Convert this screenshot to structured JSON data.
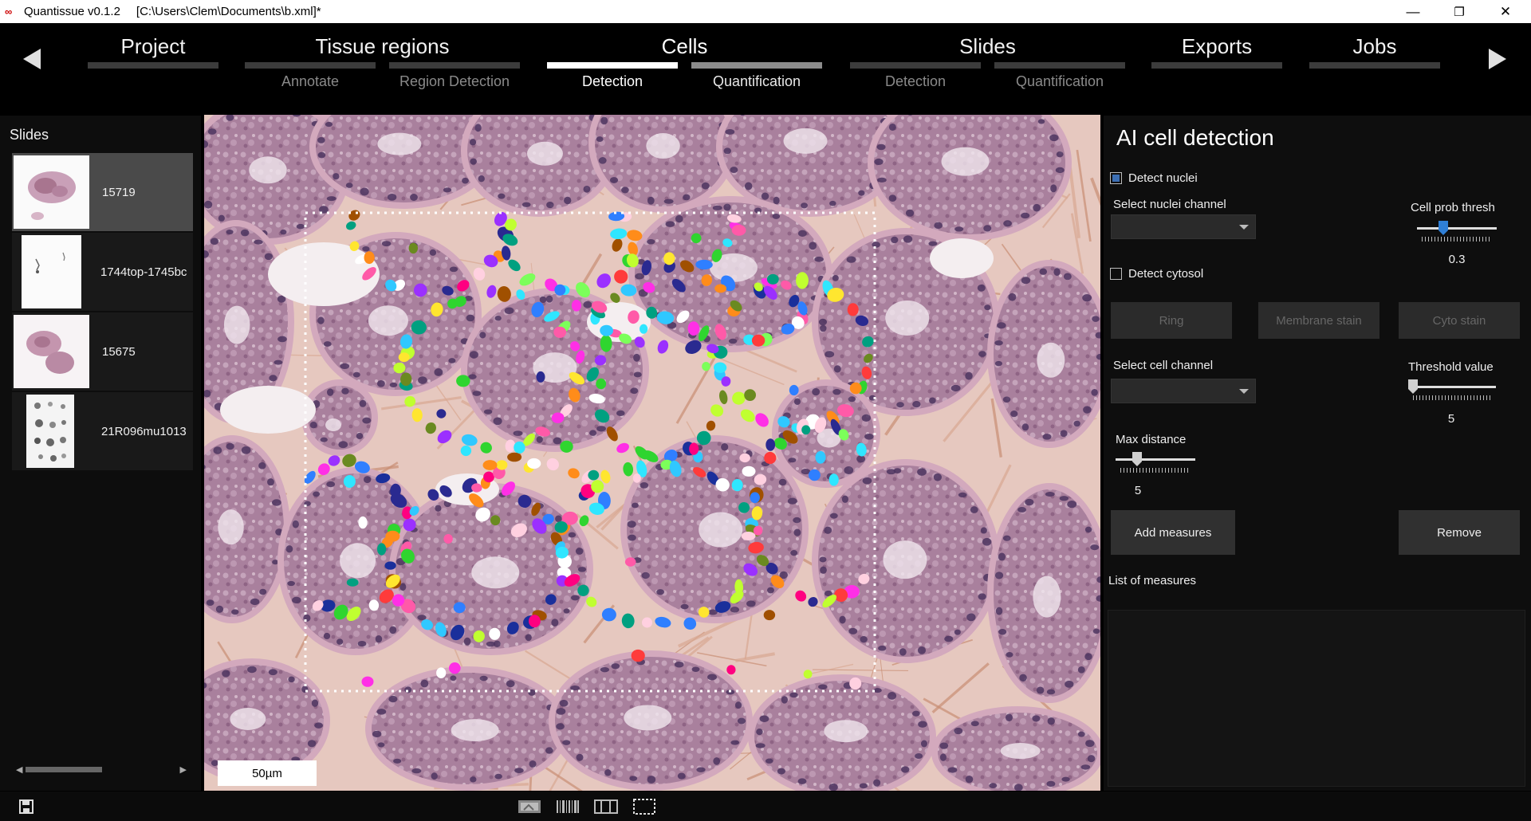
{
  "window": {
    "app_name": "Quantissue v0.1.2",
    "file_path": "[C:\\Users\\Clem\\Documents\\b.xml]*",
    "minimize": "—",
    "restore": "❐",
    "close": "✕"
  },
  "nav": {
    "groups": [
      {
        "label": "Project",
        "state": "inactive"
      },
      {
        "label": "Tissue regions",
        "state": "inactive"
      },
      {
        "label": "Cells",
        "state": "active"
      },
      {
        "label": "Slides",
        "state": "inactive"
      },
      {
        "label": "Exports",
        "state": "inactive"
      },
      {
        "label": "Jobs",
        "state": "inactive"
      }
    ],
    "subtabs": [
      {
        "label": "Annotate",
        "state": "inactive"
      },
      {
        "label": "Region Detection",
        "state": "inactive"
      },
      {
        "label": "Detection",
        "state": "active"
      },
      {
        "label": "Quantification",
        "state": "available"
      },
      {
        "label": "Detection",
        "state": "inactive"
      },
      {
        "label": "Quantification",
        "state": "inactive"
      }
    ]
  },
  "slides": {
    "title": "Slides",
    "items": [
      {
        "label": "15719",
        "selected": true
      },
      {
        "label": "1744top-1745bc",
        "selected": false
      },
      {
        "label": "15675",
        "selected": false
      },
      {
        "label": "21R096mu1013",
        "selected": false
      }
    ]
  },
  "viewer": {
    "scale_label": "50µm"
  },
  "panel": {
    "title": "AI cell detection",
    "detect_nuclei": {
      "label": "Detect nuclei",
      "checked": true
    },
    "nuclei_channel_label": "Select nuclei channel",
    "cell_prob": {
      "label": "Cell prob thresh",
      "value": "0.3",
      "fraction": 0.3
    },
    "detect_cytosol": {
      "label": "Detect cytosol",
      "checked": false
    },
    "buttons": {
      "ring": "Ring",
      "membrane": "Membrane stain",
      "cyto": "Cyto stain",
      "add": "Add measures",
      "remove": "Remove"
    },
    "cell_channel_label": "Select cell channel",
    "threshold": {
      "label": "Threshold value",
      "value": "5",
      "fraction": 0.0
    },
    "max_distance": {
      "label": "Max distance",
      "value": "5",
      "fraction": 0.25
    },
    "list_label": "List of measures"
  },
  "colors": {
    "accent": "#3c6fb4",
    "slider_knob": "#2f7fd6"
  }
}
